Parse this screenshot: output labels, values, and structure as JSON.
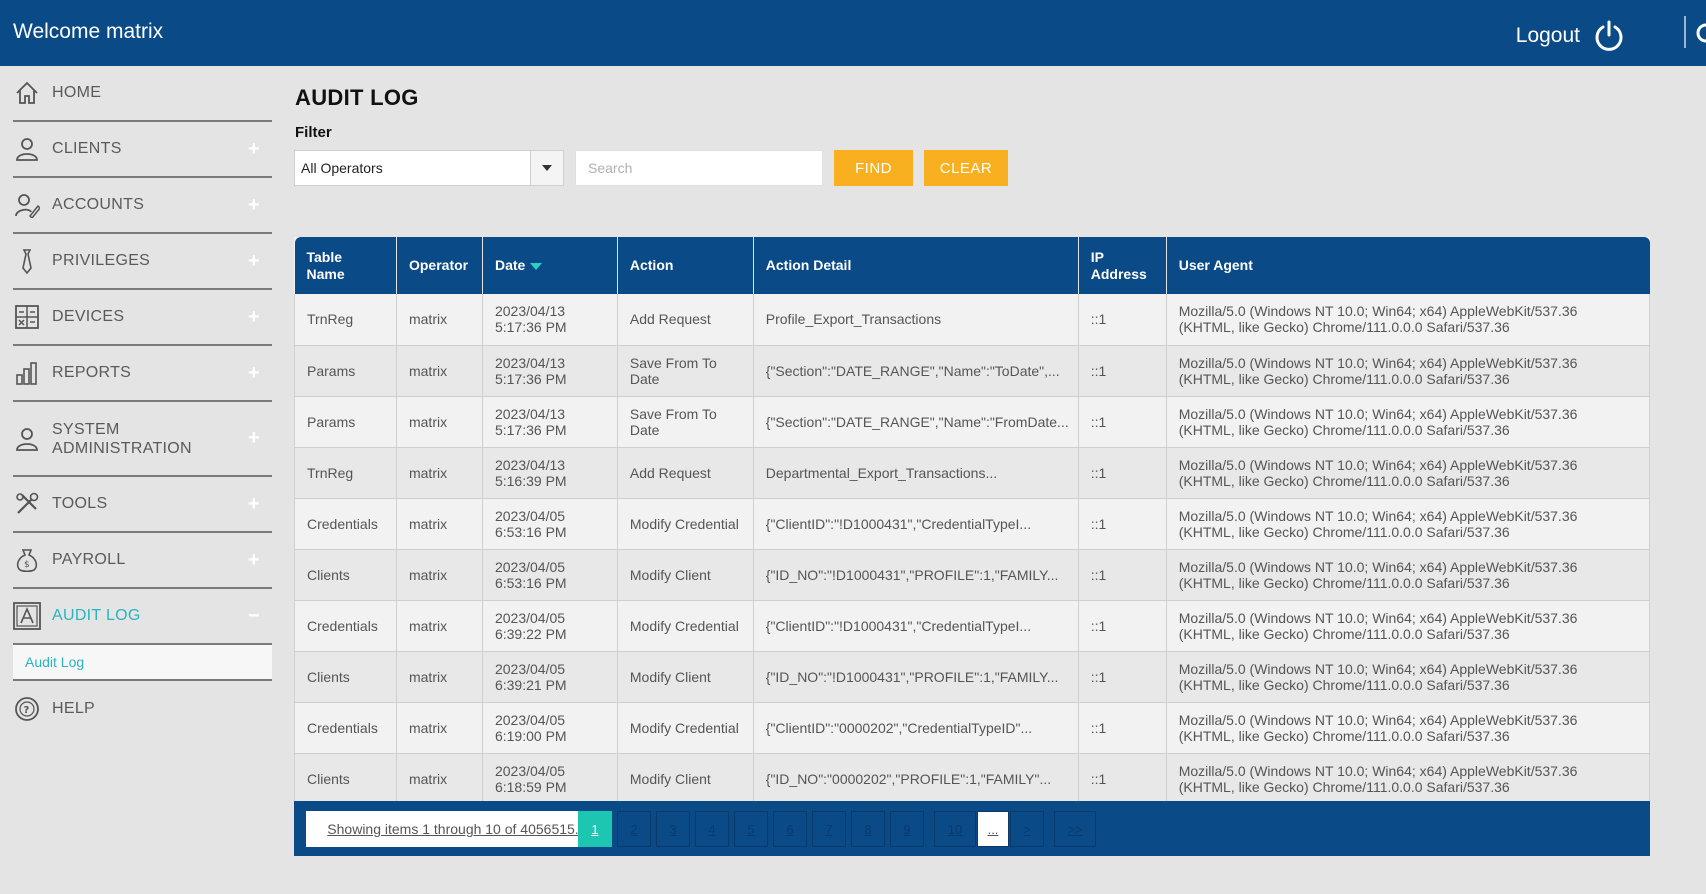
{
  "header": {
    "welcome": "Welcome matrix",
    "logout_label": "Logout"
  },
  "sidebar": {
    "items": [
      {
        "label": "HOME",
        "icon": "home-icon",
        "expandable": false
      },
      {
        "label": "CLIENTS",
        "icon": "user-icon",
        "expandable": true
      },
      {
        "label": "ACCOUNTS",
        "icon": "user-edit-icon",
        "expandable": true
      },
      {
        "label": "PRIVILEGES",
        "icon": "tie-icon",
        "expandable": true
      },
      {
        "label": "DEVICES",
        "icon": "calculator-icon",
        "expandable": true
      },
      {
        "label": "REPORTS",
        "icon": "bar-chart-icon",
        "expandable": true
      },
      {
        "label": "SYSTEM ADMINISTRATION",
        "icon": "admin-user-icon",
        "expandable": true
      },
      {
        "label": "TOOLS",
        "icon": "tools-icon",
        "expandable": true
      },
      {
        "label": "PAYROLL",
        "icon": "money-bag-icon",
        "expandable": true
      },
      {
        "label": "AUDIT LOG",
        "icon": "audit-icon",
        "expandable": true,
        "active": true
      },
      {
        "label": "HELP",
        "icon": "help-icon",
        "expandable": false
      }
    ],
    "sub_item": "Audit Log",
    "plus": "+",
    "minus": "−",
    "active_color": "#2bb3c0"
  },
  "page": {
    "title": "AUDIT LOG",
    "filter_label": "Filter",
    "operator_select": "All Operators",
    "search_placeholder": "Search",
    "find_label": "FIND",
    "clear_label": "CLEAR"
  },
  "table": {
    "headers": [
      "Table Name",
      "Operator",
      "Date",
      "Action",
      "Action Detail",
      "IP Address",
      "User Agent"
    ],
    "rows": [
      [
        "TrnReg",
        "matrix",
        "2023/04/13 5:17:36 PM",
        "Add Request",
        "Profile_Export_Transactions",
        "::1",
        "Mozilla/5.0 (Windows NT 10.0; Win64; x64) AppleWebKit/537.36 (KHTML, like Gecko) Chrome/111.0.0.0 Safari/537.36"
      ],
      [
        "Params",
        "matrix",
        "2023/04/13 5:17:36 PM",
        "Save From To Date",
        "{\"Section\":\"DATE_RANGE\",\"Name\":\"ToDate\",...",
        "::1",
        "Mozilla/5.0 (Windows NT 10.0; Win64; x64) AppleWebKit/537.36 (KHTML, like Gecko) Chrome/111.0.0.0 Safari/537.36"
      ],
      [
        "Params",
        "matrix",
        "2023/04/13 5:17:36 PM",
        "Save From To Date",
        "{\"Section\":\"DATE_RANGE\",\"Name\":\"FromDate...",
        "::1",
        "Mozilla/5.0 (Windows NT 10.0; Win64; x64) AppleWebKit/537.36 (KHTML, like Gecko) Chrome/111.0.0.0 Safari/537.36"
      ],
      [
        "TrnReg",
        "matrix",
        "2023/04/13 5:16:39 PM",
        "Add Request",
        "Departmental_Export_Transactions...",
        "::1",
        "Mozilla/5.0 (Windows NT 10.0; Win64; x64) AppleWebKit/537.36 (KHTML, like Gecko) Chrome/111.0.0.0 Safari/537.36"
      ],
      [
        "Credentials",
        "matrix",
        "2023/04/05 6:53:16 PM",
        "Modify Credential",
        "{\"ClientID\":\"!D1000431\",\"CredentialTypeI...",
        "::1",
        "Mozilla/5.0 (Windows NT 10.0; Win64; x64) AppleWebKit/537.36 (KHTML, like Gecko) Chrome/111.0.0.0 Safari/537.36"
      ],
      [
        "Clients",
        "matrix",
        "2023/04/05 6:53:16 PM",
        "Modify Client",
        "{\"ID_NO\":\"!D1000431\",\"PROFILE\":1,\"FAMILY...",
        "::1",
        "Mozilla/5.0 (Windows NT 10.0; Win64; x64) AppleWebKit/537.36 (KHTML, like Gecko) Chrome/111.0.0.0 Safari/537.36"
      ],
      [
        "Credentials",
        "matrix",
        "2023/04/05 6:39:22 PM",
        "Modify Credential",
        "{\"ClientID\":\"!D1000431\",\"CredentialTypeI...",
        "::1",
        "Mozilla/5.0 (Windows NT 10.0; Win64; x64) AppleWebKit/537.36 (KHTML, like Gecko) Chrome/111.0.0.0 Safari/537.36"
      ],
      [
        "Clients",
        "matrix",
        "2023/04/05 6:39:21 PM",
        "Modify Client",
        "{\"ID_NO\":\"!D1000431\",\"PROFILE\":1,\"FAMILY...",
        "::1",
        "Mozilla/5.0 (Windows NT 10.0; Win64; x64) AppleWebKit/537.36 (KHTML, like Gecko) Chrome/111.0.0.0 Safari/537.36"
      ],
      [
        "Credentials",
        "matrix",
        "2023/04/05 6:19:00 PM",
        "Modify Credential",
        "{\"ClientID\":\"0000202\",\"CredentialTypeID\"...",
        "::1",
        "Mozilla/5.0 (Windows NT 10.0; Win64; x64) AppleWebKit/537.36 (KHTML, like Gecko) Chrome/111.0.0.0 Safari/537.36"
      ],
      [
        "Clients",
        "matrix",
        "2023/04/05 6:18:59 PM",
        "Modify Client",
        "{\"ID_NO\":\"0000202\",\"PROFILE\":1,\"FAMILY\"...",
        "::1",
        "Mozilla/5.0 (Windows NT 10.0; Win64; x64) AppleWebKit/537.36 (KHTML, like Gecko) Chrome/111.0.0.0 Safari/537.36"
      ]
    ]
  },
  "pager": {
    "info": "Showing items 1 through 10 of 4056515.",
    "pages": [
      "1",
      "2",
      "3",
      "4",
      "5",
      "6",
      "7",
      "8",
      "9",
      "10",
      "...",
      ">",
      ">>"
    ],
    "current": "1"
  },
  "colors": {
    "brand": "#0a4a87",
    "accent_button": "#f8b020",
    "active_page": "#1cc6b0"
  }
}
